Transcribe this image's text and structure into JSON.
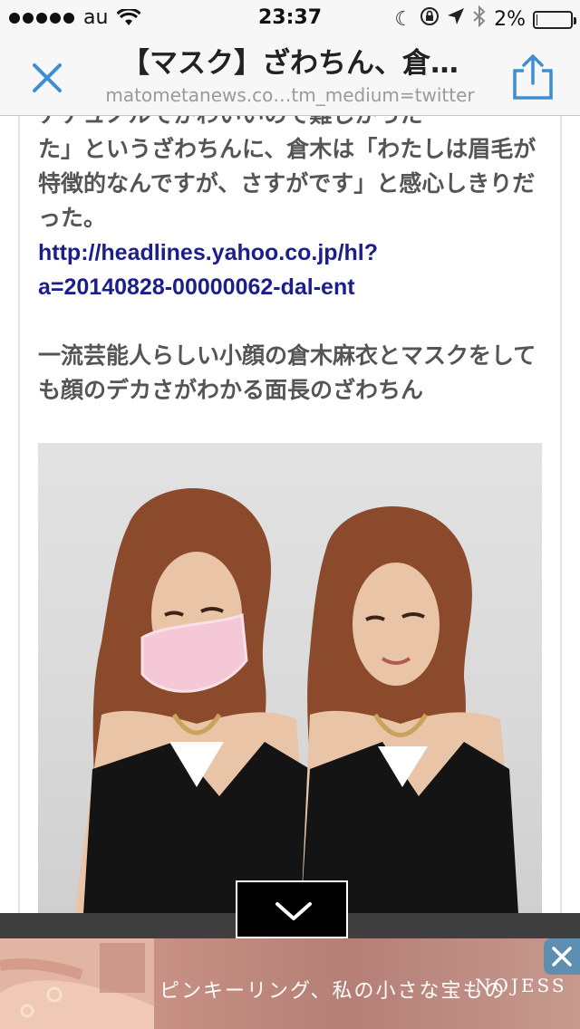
{
  "status_bar": {
    "carrier": "au",
    "time": "23:37",
    "battery_percent": "2%",
    "battery_level": 0.02,
    "icons": [
      "signal-dots-icon",
      "wifi-icon",
      "moon-icon",
      "rotation-lock-icon",
      "location-arrow-icon",
      "bluetooth-icon",
      "battery-icon"
    ]
  },
  "nav": {
    "title": "【マスク】ざわちん、倉…",
    "url": "matometanews.co…tm_medium=twitter",
    "close_icon": "close-icon",
    "share_icon": "share-icon",
    "accent_color": "#3d8fd1"
  },
  "article": {
    "cut_line": "アナュノルでかわいいので難しかった",
    "paragraph1": "た」というざわちんに、倉木は「わたしは眉毛が特徴的なんですが、さすがです」と感心しきりだった。",
    "link_line1": "http://headlines.yahoo.co.jp/hl?",
    "link_line2": "a=20140828-00000062-dal-ent",
    "caption": "一流芸能人らしい小顔の倉木麻衣とマスクをしても顔のデカさがわかる面長のざわちん",
    "link_color": "#1a1f8c",
    "text_color": "#555555"
  },
  "photo": {
    "icon": "photo-image"
  },
  "toolbar": {
    "expand_icon": "chevron-down-icon"
  },
  "ad": {
    "text": "ピンキーリング、私の小さな宝もの",
    "brand": "NOJESS",
    "close_icon": "close-icon"
  }
}
